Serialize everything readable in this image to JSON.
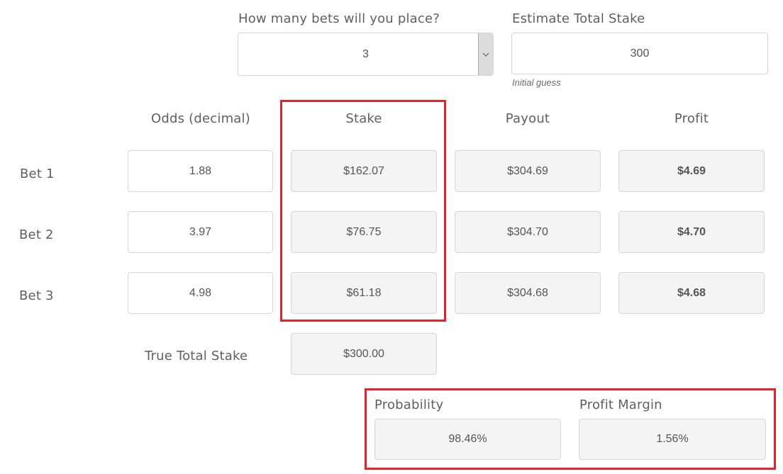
{
  "bets_count": {
    "label": "How many bets will you place?",
    "selected": "3"
  },
  "estimate": {
    "label": "Estimate Total Stake",
    "value": "300",
    "hint": "Initial guess"
  },
  "columns": {
    "odds": "Odds (decimal)",
    "stake": "Stake",
    "payout": "Payout",
    "profit": "Profit"
  },
  "rows": [
    {
      "label": "Bet 1",
      "odds": "1.88",
      "stake": "$162.07",
      "payout": "$304.69",
      "profit": "$4.69"
    },
    {
      "label": "Bet 2",
      "odds": "3.97",
      "stake": "$76.75",
      "payout": "$304.70",
      "profit": "$4.70"
    },
    {
      "label": "Bet 3",
      "odds": "4.98",
      "stake": "$61.18",
      "payout": "$304.68",
      "profit": "$4.68"
    }
  ],
  "total": {
    "label": "True Total Stake",
    "value": "$300.00"
  },
  "summary": {
    "probability_label": "Probability",
    "probability_value": "98.46%",
    "margin_label": "Profit Margin",
    "margin_value": "1.56%"
  },
  "colors": {
    "highlight": "#e3242b",
    "output_bg": "#f4f4f4"
  }
}
